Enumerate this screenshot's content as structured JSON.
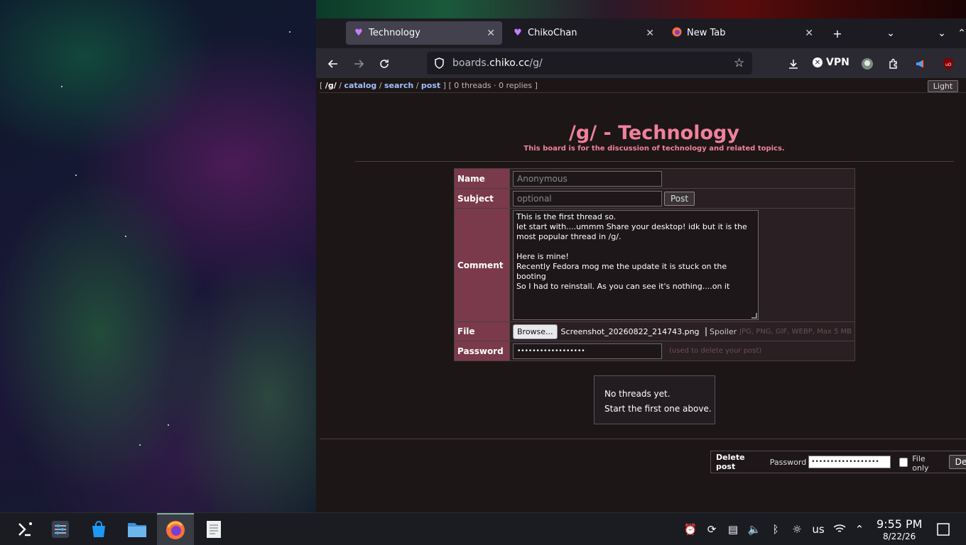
{
  "browser": {
    "tabs": [
      {
        "title": "Technology",
        "icon": "heart-icon",
        "active": true
      },
      {
        "title": "ChikoChan",
        "icon": "heart-icon",
        "active": false
      },
      {
        "title": "New Tab",
        "icon": "firefox-icon",
        "active": false
      }
    ],
    "url_prefix": "boards.",
    "url_domain": "chiko.cc",
    "url_path": "/g/",
    "vpn_label": "VPN"
  },
  "boardnav": {
    "open": "[",
    "board": "/g/",
    "sep": "/",
    "catalog": "catalog",
    "search": "search",
    "post": "post",
    "close": "]",
    "stats": "[ 0 threads · 0 replies ]",
    "theme_button": "Light"
  },
  "board": {
    "title": "/g/ - Technology",
    "description": "This board is for the discussion of technology and related topics."
  },
  "form": {
    "name_label": "Name",
    "name_placeholder": "Anonymous",
    "subject_label": "Subject",
    "subject_placeholder": "optional",
    "post_button": "Post",
    "comment_label": "Comment",
    "comment_value": "This is the first thread so.\nlet start with....ummm Share your desktop! idk but it is the most popular thread in /g/.\n\nHere is mine!\nRecently Fedora mog me the update it is stuck on the booting\nSo I had to reinstall. As you can see it's nothing....on it",
    "file_label": "File",
    "browse_button": "Browse...",
    "file_name": "Screenshot_20260822_214743.png",
    "spoiler_label": "Spoiler",
    "file_hint": "JPG, PNG, GIF, WEBP, Max 5 MB",
    "password_label": "Password",
    "password_value": "••••••••••••••••••",
    "password_hint": "(used to delete your post)"
  },
  "threads": {
    "empty_line1": "No threads yet.",
    "empty_line2": "Start the first one above."
  },
  "delete": {
    "title": "Delete post",
    "password_label": "Password",
    "password_value": "••••••••••••••••••",
    "file_only_label": "File only",
    "button": "Dele"
  },
  "taskbar": {
    "keyboard_layout": "us",
    "time": "9:55 PM",
    "date": "8/22/26"
  },
  "colors": {
    "board_accent": "#f0819b",
    "form_label_bg": "#7a3a4c",
    "link": "#9fc0ff"
  }
}
